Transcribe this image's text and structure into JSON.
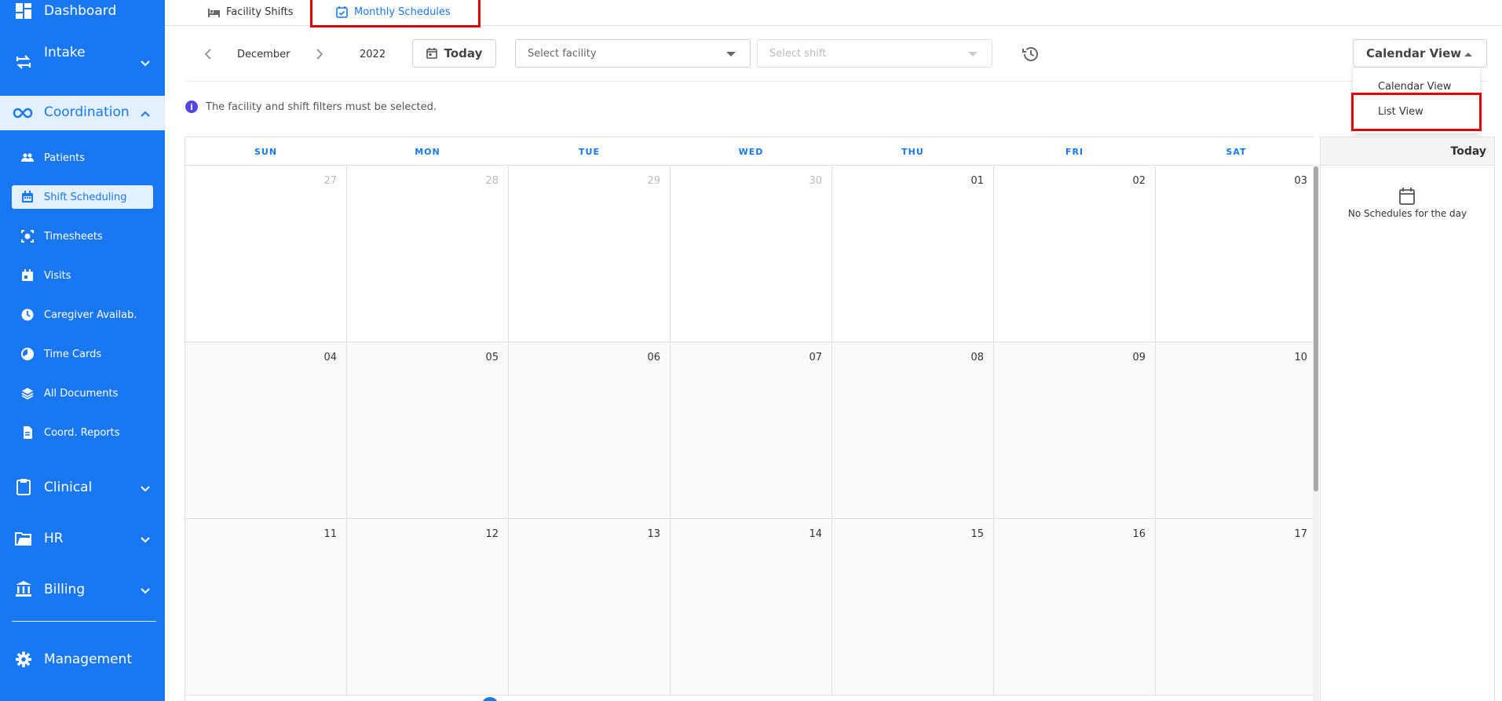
{
  "sidebar": {
    "dashboard": "Dashboard",
    "intake": "Intake",
    "coordination": "Coordination",
    "coordination_items": [
      {
        "label": "Patients",
        "icon": "people-icon"
      },
      {
        "label": "Shift Scheduling",
        "icon": "calendar-icon"
      },
      {
        "label": "Timesheets",
        "icon": "timesheet-icon"
      },
      {
        "label": "Visits",
        "icon": "calendar-check-icon"
      },
      {
        "label": "Caregiver Availab.",
        "icon": "clock-icon"
      },
      {
        "label": "Time Cards",
        "icon": "timer-icon"
      },
      {
        "label": "All Documents",
        "icon": "layers-icon"
      },
      {
        "label": "Coord. Reports",
        "icon": "document-icon"
      }
    ],
    "clinical": "Clinical",
    "hr": "HR",
    "billing": "Billing",
    "management": "Management"
  },
  "tabs": {
    "facility_shifts": "Facility Shifts",
    "monthly_schedules": "Monthly Schedules"
  },
  "toolbar": {
    "month": "December",
    "year": "2022",
    "today": "Today",
    "facility_placeholder": "Select facility",
    "shift_placeholder": "Select shift",
    "view_select": "Calendar View"
  },
  "view_menu": {
    "calendar_view": "Calendar View",
    "list_view": "List View"
  },
  "notice": "The facility and shift filters must be selected.",
  "calendar": {
    "weekdays": [
      "SUN",
      "MON",
      "TUE",
      "WED",
      "THU",
      "FRI",
      "SAT"
    ],
    "weeks": [
      [
        {
          "d": "27",
          "muted": true
        },
        {
          "d": "28",
          "muted": true
        },
        {
          "d": "29",
          "muted": true
        },
        {
          "d": "30",
          "muted": true
        },
        {
          "d": "01"
        },
        {
          "d": "02"
        },
        {
          "d": "03"
        }
      ],
      [
        {
          "d": "04"
        },
        {
          "d": "05"
        },
        {
          "d": "06"
        },
        {
          "d": "07"
        },
        {
          "d": "08"
        },
        {
          "d": "09"
        },
        {
          "d": "10"
        }
      ],
      [
        {
          "d": "11"
        },
        {
          "d": "12"
        },
        {
          "d": "13"
        },
        {
          "d": "14"
        },
        {
          "d": "15"
        },
        {
          "d": "16"
        },
        {
          "d": "17"
        }
      ]
    ]
  },
  "right_panel": {
    "title": "Today",
    "empty_message": "No Schedules for the day"
  },
  "colors": {
    "primary": "#1877f2",
    "highlight_border": "#e00000",
    "active_bg": "#e3f0ff"
  }
}
